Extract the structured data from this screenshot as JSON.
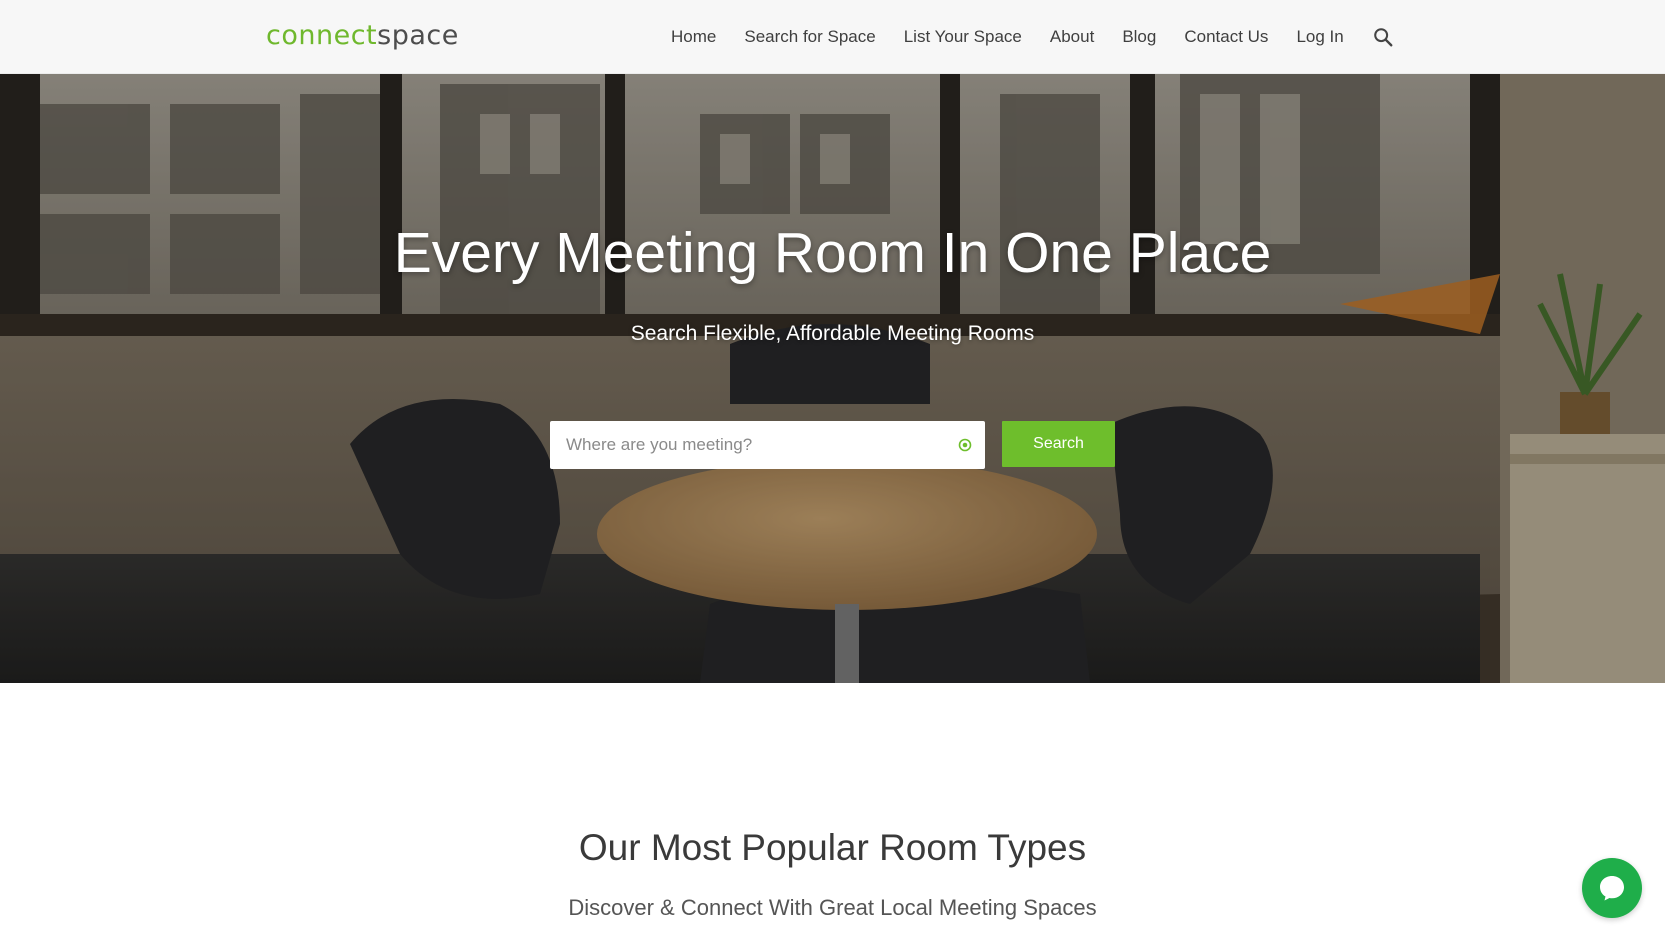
{
  "brand": {
    "logo_part1": "connect",
    "logo_part2": "space",
    "accent_color": "#6ebe2c"
  },
  "nav": {
    "items": [
      {
        "label": "Home"
      },
      {
        "label": "Search for Space"
      },
      {
        "label": "List Your Space"
      },
      {
        "label": "About"
      },
      {
        "label": "Blog"
      },
      {
        "label": "Contact Us"
      },
      {
        "label": "Log In"
      }
    ],
    "search_icon": "search-icon"
  },
  "hero": {
    "title": "Every Meeting Room In One Place",
    "subtitle": "Search Flexible, Affordable Meeting Rooms",
    "search": {
      "placeholder": "Where are you meeting?",
      "value": "",
      "button_label": "Search",
      "locate_icon": "crosshair-icon"
    }
  },
  "popular": {
    "title": "Our Most Popular Room Types",
    "subtitle": "Discover & Connect With Great Local Meeting Spaces"
  },
  "chat": {
    "icon": "chat-bubble-icon",
    "color": "#1fae4a"
  }
}
